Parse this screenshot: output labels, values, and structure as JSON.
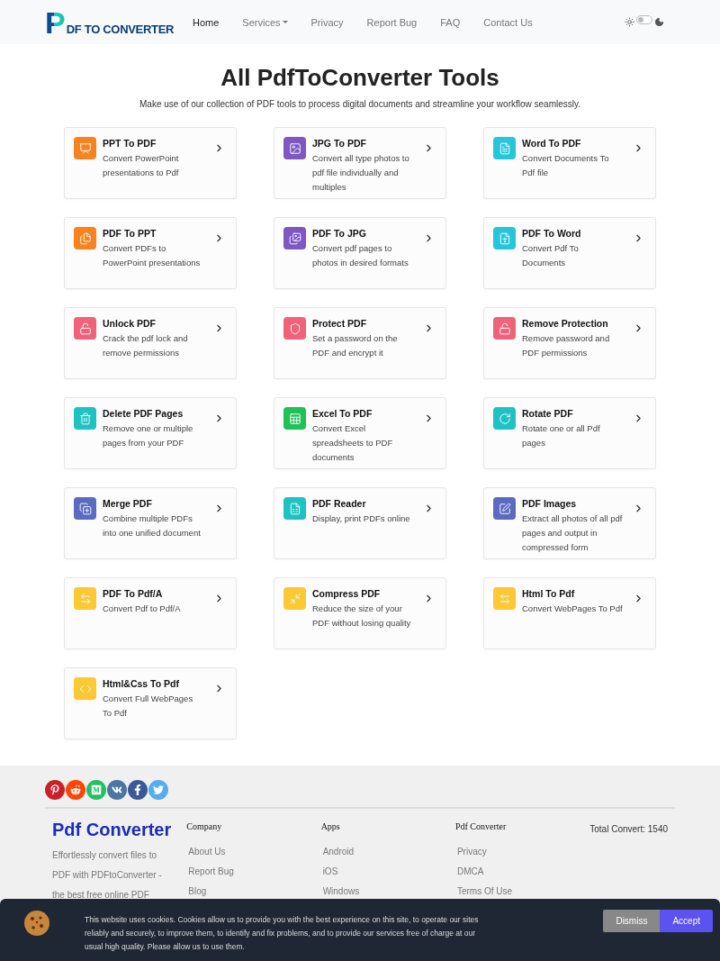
{
  "header": {
    "logo": {
      "mark": "P",
      "text": "DF TO CONVERTER"
    },
    "nav": [
      {
        "label": "Home",
        "selected": true,
        "dropdown": false
      },
      {
        "label": "Services",
        "selected": false,
        "dropdown": true
      },
      {
        "label": "Privacy",
        "selected": false,
        "dropdown": false
      },
      {
        "label": "Report Bug",
        "selected": false,
        "dropdown": false
      },
      {
        "label": "FAQ",
        "selected": false,
        "dropdown": false
      },
      {
        "label": "Contact Us",
        "selected": false,
        "dropdown": false
      }
    ],
    "theme_switch": {
      "on": false
    }
  },
  "hero": {
    "title": "All PdfToConverter Tools",
    "subtitle": "Make use of our collection of PDF tools to process digital documents and streamline your workflow seamlessly."
  },
  "tools": [
    {
      "title": "PPT To PDF",
      "description": "Convert PowerPoint presentations to Pdf",
      "color": "#f7831f"
    },
    {
      "title": "JPG To PDF",
      "description": "Convert all type photos to pdf file individually and multiples",
      "color": "#7e57c2"
    },
    {
      "title": "Word To PDF",
      "description": "Convert Documents To Pdf file",
      "color": "#26c6da"
    },
    {
      "title": "PDF To PPT",
      "description": "Convert PDFs to PowerPoint presentations",
      "color": "#f7831f"
    },
    {
      "title": "PDF To JPG",
      "description": "Convert pdf pages to photos in desired formats",
      "color": "#7e57c2"
    },
    {
      "title": "PDF To Word",
      "description": "Convert Pdf To Documents",
      "color": "#26c6da"
    },
    {
      "title": "Unlock PDF",
      "description": "Crack the pdf lock and remove permissions",
      "color": "#f0627a"
    },
    {
      "title": "Protect PDF",
      "description": "Set a password on the PDF and encrypt it",
      "color": "#f0627a"
    },
    {
      "title": "Remove Protection",
      "description": "Remove password and PDF permissions",
      "color": "#f0627a"
    },
    {
      "title": "Delete PDF Pages",
      "description": "Remove one or multiple pages from your PDF",
      "color": "#1fc2c2"
    },
    {
      "title": "Excel To PDF",
      "description": "Convert Excel spreadsheets to PDF documents",
      "color": "#21c15a"
    },
    {
      "title": "Rotate PDF",
      "description": "Rotate one or all Pdf pages",
      "color": "#1fc2c2"
    },
    {
      "title": "Merge PDF",
      "description": "Combine multiple PDFs into one unified document",
      "color": "#5c6bc0"
    },
    {
      "title": "PDF Reader",
      "description": "Display, print PDFs online",
      "color": "#1fc2c2"
    },
    {
      "title": "PDF Images",
      "description": "Extract all photos of all pdf pages and output in compressed form",
      "color": "#5c6bc0"
    },
    {
      "title": "PDF To Pdf/A",
      "description": "Convert Pdf to Pdf/A",
      "color": "#fcc934"
    },
    {
      "title": "Compress PDF",
      "description": "Reduce the size of your PDF without losing quality",
      "color": "#fcc934"
    },
    {
      "title": "Html To Pdf",
      "description": "Convert WebPages To Pdf",
      "color": "#fcc934"
    },
    {
      "title": "Html&Css To Pdf",
      "description": "Convert Full WebPages To Pdf",
      "color": "#fcc934"
    }
  ],
  "footer": {
    "brand": "Pdf Converter",
    "about": "Effortlessly convert files to PDF with PDFtoConverter - the best free online PDF",
    "columns": [
      {
        "heading": "Company",
        "links": [
          "About Us",
          "Report Bug",
          "Blog"
        ]
      },
      {
        "heading": "Apps",
        "links": [
          "Android",
          "iOS",
          "Windows"
        ]
      },
      {
        "heading": "Pdf Converter",
        "links": [
          "Privacy",
          "DMCA",
          "Terms Of Use"
        ]
      }
    ],
    "total_convert": "Total Convert: 1540"
  },
  "cookie_banner": {
    "text": "This website uses cookies. Cookies allow us to provide you with the best experience on this site, to operate our sites reliably and securely, to improve them, to identify and fix problems, and to provide our services free of charge at our usual high quality. Please allow us to use them.",
    "buttons": [
      "Dismiss",
      "Accept"
    ]
  }
}
